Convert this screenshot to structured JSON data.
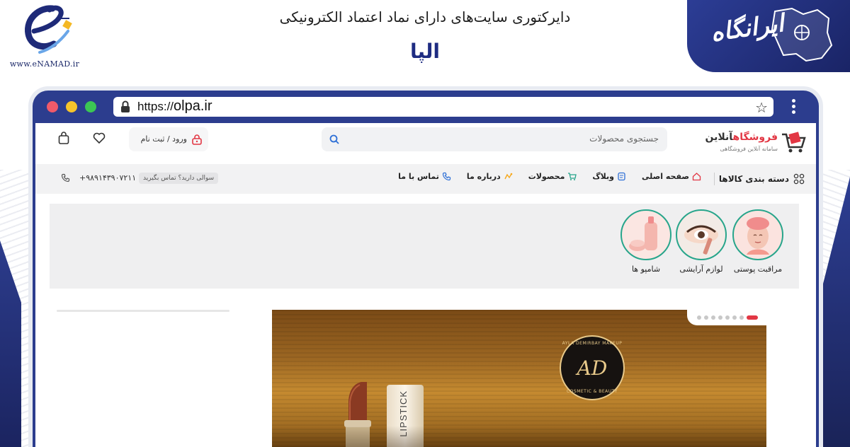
{
  "header": {
    "enamad_caption": "www.eNAMAD.ir",
    "directory_title": "دایرکتوری سایت‌های دارای نماد اعتماد الکترونیکی",
    "site_name": "الپا",
    "brand_word": "ایرانگاه"
  },
  "browser": {
    "url_protocol": "https://",
    "url_domain": "olpa.ir"
  },
  "site": {
    "logo_name_red": "فروشگاه",
    "logo_name_rest": "آنلاین",
    "logo_sub": "سامانه آنلاین فروشگاهی",
    "search_placeholder": "جستجوی محصولات",
    "login_label": "ورود / ثبت نام",
    "categories_label": "دسته بندی کالاها",
    "nav": [
      {
        "label": "صفحه اصلی",
        "icon": "home-icon"
      },
      {
        "label": "وبلاگ",
        "icon": "blog-icon"
      },
      {
        "label": "محصولات",
        "icon": "cart-icon"
      },
      {
        "label": "درباره ما",
        "icon": "about-icon"
      },
      {
        "label": "تماس با ما",
        "icon": "phone-icon"
      }
    ],
    "help_text": "سوالی دارید؟ تماس بگیرید",
    "phone": "+۹۸۹۱۴۳۹۰۷۲۱۱",
    "category_items": [
      {
        "label": "مراقبت پوستی"
      },
      {
        "label": "لوازم آرایشی"
      },
      {
        "label": "شامپو ها"
      }
    ],
    "slider_dots": 8,
    "slider_active_index": 0,
    "banner": {
      "brand_top": "AYLA DEMIRBAY MAKEUP",
      "brand_monogram": "AD",
      "brand_bottom": "COSMETIC & BEAUTY",
      "tube_text": "LIPSTICK"
    }
  },
  "colors": {
    "accent_red": "#e23744",
    "brand_blue": "#2c3d8e",
    "teal_ring": "#27a58b"
  }
}
